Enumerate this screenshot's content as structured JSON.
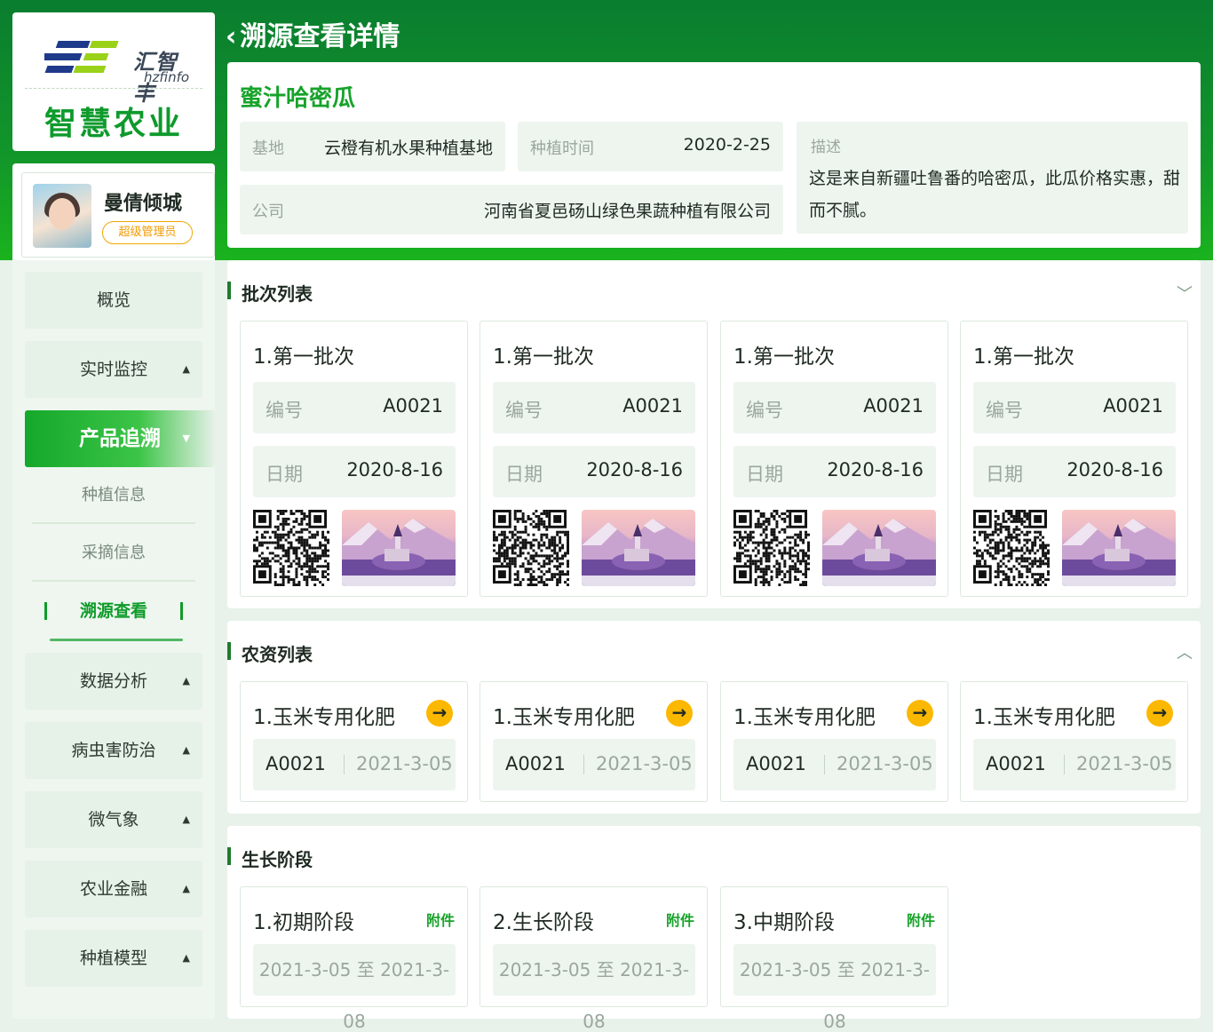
{
  "brand": {
    "logo_cn": "汇智丰",
    "logo_en": "hzfinfo",
    "title": "智慧农业",
    "logo_colors": [
      "#1f3a8a",
      "#9ad11a"
    ]
  },
  "user": {
    "name": "曼倩倾城",
    "role": "超级管理员"
  },
  "nav": [
    {
      "label": "概览",
      "icon": ""
    },
    {
      "label": "实时监控",
      "icon": "triangle-up-icon"
    },
    {
      "label": "产品追溯",
      "icon": "triangle-down-icon",
      "active": true
    },
    {
      "label": "数据分析",
      "icon": "triangle-up-icon"
    },
    {
      "label": "病虫害防治",
      "icon": "triangle-up-icon"
    },
    {
      "label": "微气象",
      "icon": "triangle-up-icon"
    },
    {
      "label": "农业金融",
      "icon": "triangle-up-icon"
    },
    {
      "label": "种植模型",
      "icon": "triangle-up-icon"
    }
  ],
  "subnav": [
    {
      "label": "种植信息"
    },
    {
      "label": "采摘信息"
    },
    {
      "label": "溯源查看",
      "active": true
    }
  ],
  "page": {
    "back_label": "溯源查看详情"
  },
  "product": {
    "name": "蜜汁哈密瓜",
    "base_label": "基地",
    "base_value": "云橙有机水果种植基地",
    "plant_time_label": "种植时间",
    "plant_time_value": "2020-2-25",
    "company_label": "公司",
    "company_value": "河南省夏邑砀山绿色果蔬种植有限公司",
    "desc_label": "描述",
    "desc_value": "这是来自新疆吐鲁番的哈密瓜，此瓜价格实惠，甜而不腻。"
  },
  "batch_section": {
    "title": "批次列表",
    "toggle_icon": "chevron-down-icon",
    "items": [
      {
        "title": "1.第一批次",
        "code_label": "编号",
        "code": "A0021",
        "date_label": "日期",
        "date": "2020-8-16"
      },
      {
        "title": "1.第一批次",
        "code_label": "编号",
        "code": "A0021",
        "date_label": "日期",
        "date": "2020-8-16"
      },
      {
        "title": "1.第一批次",
        "code_label": "编号",
        "code": "A0021",
        "date_label": "日期",
        "date": "2020-8-16"
      },
      {
        "title": "1.第一批次",
        "code_label": "编号",
        "code": "A0021",
        "date_label": "日期",
        "date": "2020-8-16"
      }
    ]
  },
  "input_section": {
    "title": "农资列表",
    "toggle_icon": "chevron-up-icon",
    "items": [
      {
        "title": "1.玉米专用化肥",
        "code": "A0021",
        "date": "2021-3-05"
      },
      {
        "title": "1.玉米专用化肥",
        "code": "A0021",
        "date": "2021-3-05"
      },
      {
        "title": "1.玉米专用化肥",
        "code": "A0021",
        "date": "2021-3-05"
      },
      {
        "title": "1.玉米专用化肥",
        "code": "A0021",
        "date": "2021-3-05"
      }
    ]
  },
  "growth_section": {
    "title": "生长阶段",
    "items": [
      {
        "title": "1.初期阶段",
        "attach": "附件",
        "range": "2021-3-05 至 2021-3-08"
      },
      {
        "title": "2.生长阶段",
        "attach": "附件",
        "range": "2021-3-05 至 2021-3-08"
      },
      {
        "title": "3.中期阶段",
        "attach": "附件",
        "range": "2021-3-05 至 2021-3-08"
      }
    ]
  },
  "colors": {
    "primary": "#17a32a",
    "dark_green": "#0a7d2f",
    "accent": "#fbb800"
  }
}
